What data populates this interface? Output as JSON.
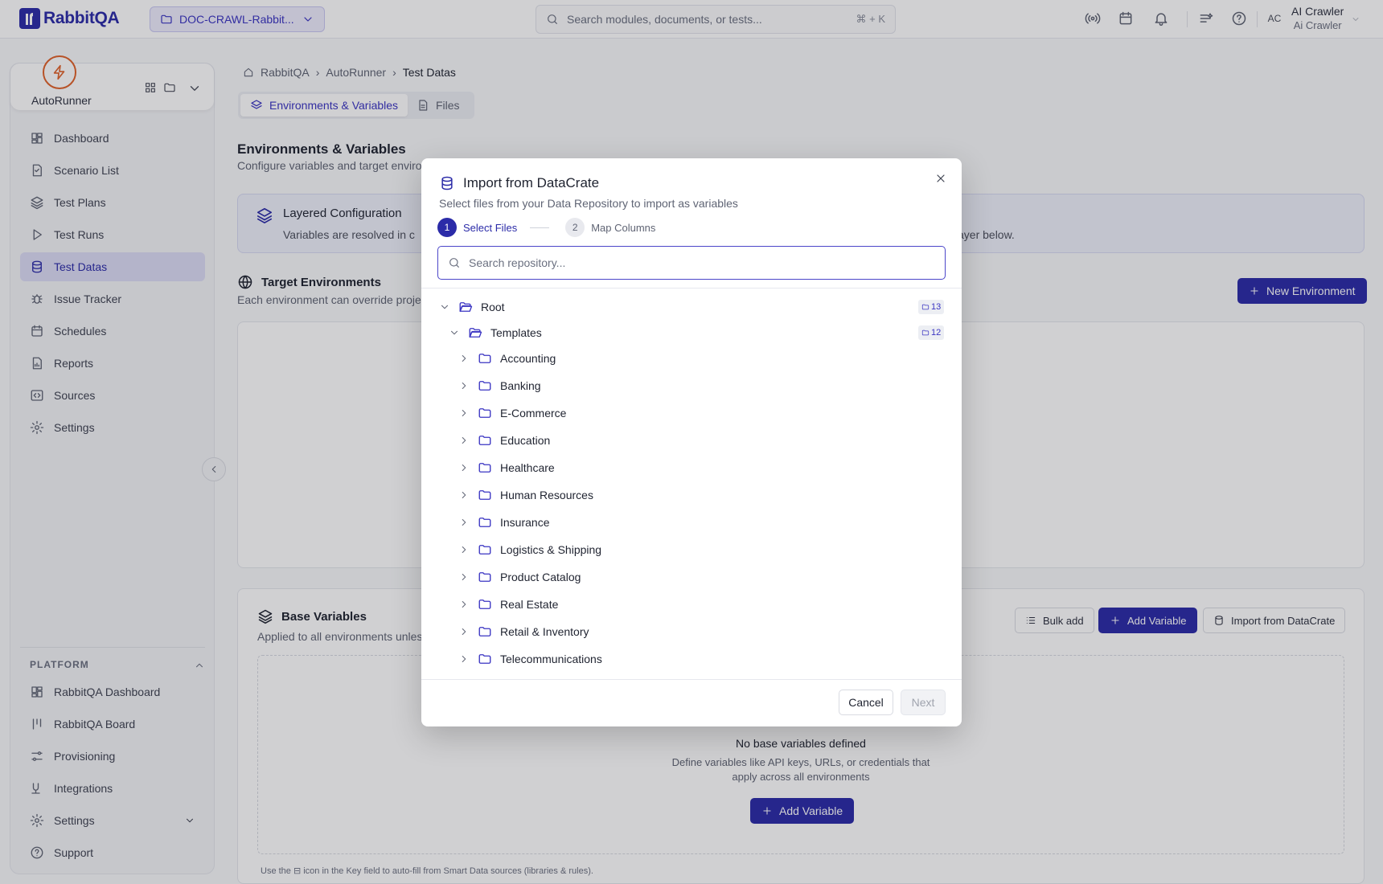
{
  "app": {
    "name": "RabbitQA"
  },
  "header": {
    "project": "DOC-CRAWL-Rabbit...",
    "search_placeholder": "Search modules, documents, or tests...",
    "search_shortcut": "⌘ + K",
    "user_initials": "AC",
    "user_name": "AI Crawler",
    "user_role": "Ai Crawler"
  },
  "sidebar": {
    "module_name": "AutoRunner",
    "items": [
      {
        "label": "Dashboard",
        "icon": "dashboard-icon"
      },
      {
        "label": "Scenario List",
        "icon": "scenario-icon"
      },
      {
        "label": "Test Plans",
        "icon": "layers-icon"
      },
      {
        "label": "Test Runs",
        "icon": "play-icon"
      },
      {
        "label": "Test Datas",
        "icon": "database-icon",
        "active": true
      },
      {
        "label": "Issue Tracker",
        "icon": "bug-icon"
      },
      {
        "label": "Schedules",
        "icon": "calendar-icon"
      },
      {
        "label": "Reports",
        "icon": "report-icon"
      },
      {
        "label": "Sources",
        "icon": "code-icon"
      },
      {
        "label": "Settings",
        "icon": "gear-icon"
      }
    ],
    "platform_label": "PLATFORM",
    "platform_items": [
      {
        "label": "RabbitQA Dashboard",
        "icon": "dashboard-icon"
      },
      {
        "label": "RabbitQA Board",
        "icon": "board-icon"
      },
      {
        "label": "Provisioning",
        "icon": "sliders-icon"
      },
      {
        "label": "Integrations",
        "icon": "plug-icon"
      },
      {
        "label": "Settings",
        "icon": "gear-icon"
      },
      {
        "label": "Support",
        "icon": "help-icon"
      }
    ]
  },
  "breadcrumb": [
    "RabbitQA",
    "AutoRunner",
    "Test Datas"
  ],
  "tabs": [
    "Environments & Variables",
    "Files"
  ],
  "page": {
    "title": "Environments & Variables",
    "subtitle": "Configure variables and target enviro",
    "info_title": "Layered Configuration",
    "info_desc_left": "Variables are resolved in c",
    "info_desc_right": "ayer below.",
    "target_title": "Target Environments",
    "target_sub": "Each environment can override projec",
    "new_env_button": "New Environment",
    "base_title": "Base Variables",
    "base_sub": "Applied to all environments unles",
    "bulk_add": "Bulk add",
    "add_variable": "Add Variable",
    "import_button": "Import from DataCrate",
    "empty_title": "No base variables defined",
    "empty_desc_1": "Define variables like API keys, URLs, or credentials that",
    "empty_desc_2": "apply across all environments",
    "empty_add": "Add Variable",
    "hint": "Use the ⊟ icon in the Key field to auto-fill from Smart Data sources (libraries & rules)."
  },
  "modal": {
    "title": "Import from DataCrate",
    "description": "Select files from your Data Repository to import as variables",
    "steps": [
      {
        "num": "1",
        "label": "Select Files"
      },
      {
        "num": "2",
        "label": "Map Columns"
      }
    ],
    "search_placeholder": "Search repository...",
    "root": {
      "label": "Root",
      "count": "13"
    },
    "templates": {
      "label": "Templates",
      "count": "12"
    },
    "folders": [
      "Accounting",
      "Banking",
      "E-Commerce",
      "Education",
      "Healthcare",
      "Human Resources",
      "Insurance",
      "Logistics & Shipping",
      "Product Catalog",
      "Real Estate",
      "Retail & Inventory",
      "Telecommunications"
    ],
    "cancel": "Cancel",
    "next": "Next"
  },
  "colors": {
    "primary": "#2b2ba8",
    "accent_orange": "#e0622a"
  }
}
